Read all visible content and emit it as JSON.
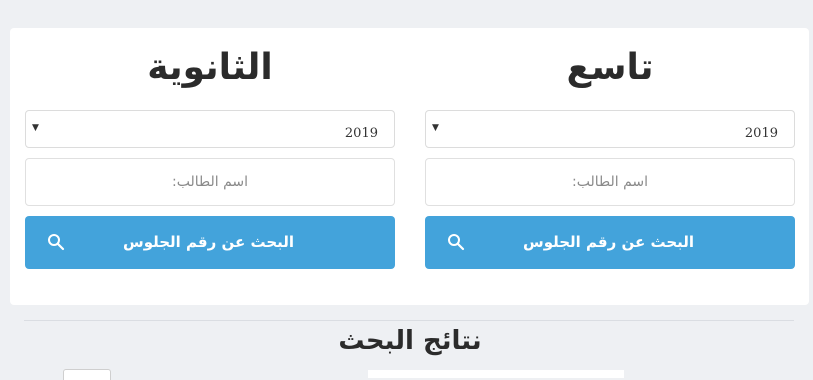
{
  "left_panel": {
    "title": "الثانوية",
    "year": "2019",
    "name_placeholder": "اسم الطالب:",
    "search_button": "البحث عن رقم الجلوس"
  },
  "right_panel": {
    "title": "تاسع",
    "year": "2019",
    "name_placeholder": "اسم الطالب:",
    "search_button": "البحث عن رقم الجلوس"
  },
  "results": {
    "title": "نتائج البحث"
  },
  "colors": {
    "accent": "#43a3db",
    "background": "#eef0f3",
    "card": "#ffffff"
  },
  "icons": {
    "search": "search-icon",
    "dropdown": "caret-down-icon"
  }
}
